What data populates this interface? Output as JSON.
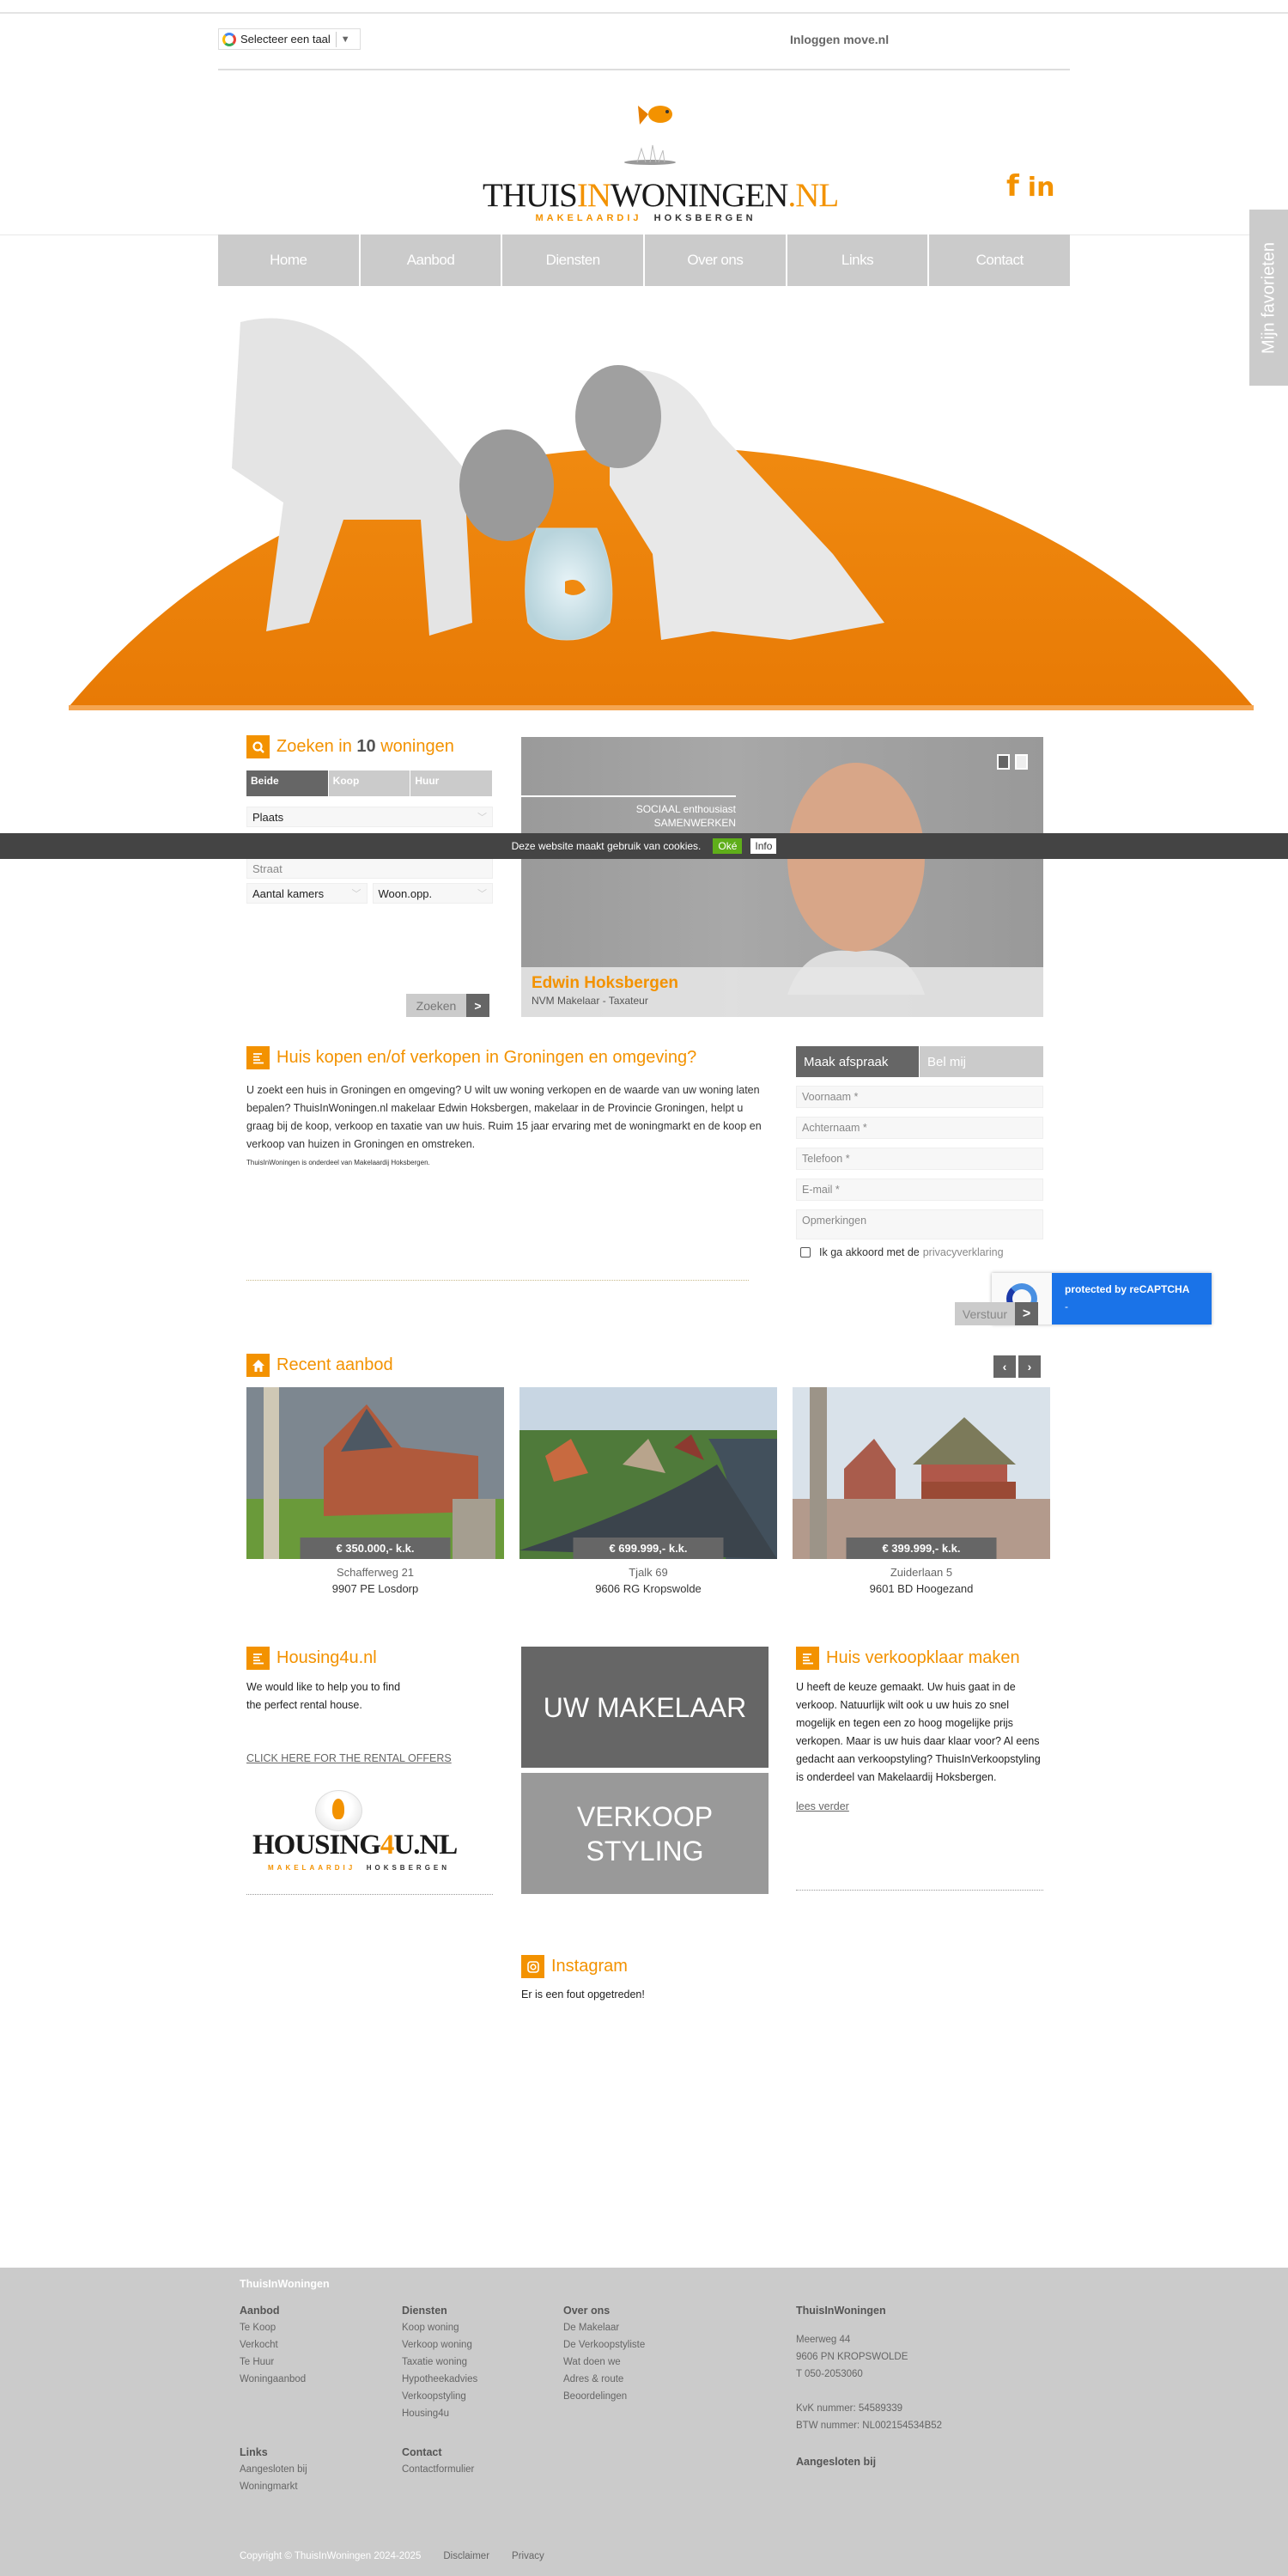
{
  "topbar": {
    "language_selector": "Selecteer een taal",
    "login_link": "Inloggen move.nl"
  },
  "logo": {
    "part1": "THUIS",
    "part2": "IN",
    "part3": "WONINGEN",
    "part4": ".NL",
    "sub1": "MAKELAARDIJ",
    "sub2": "HOKSBERGEN"
  },
  "social": {
    "facebook": "f",
    "linkedin": "in"
  },
  "nav": [
    "Home",
    "Aanbod",
    "Diensten",
    "Over ons",
    "Links",
    "Contact"
  ],
  "favorites_tab": "Mijn favorieten",
  "search": {
    "title_pre": "Zoeken in",
    "count": "10",
    "title_post": "woningen",
    "tabs": [
      "Beide",
      "Koop",
      "Huur"
    ],
    "active_tab": "Beide",
    "place": "Plaats",
    "street_placeholder": "Straat",
    "rooms": "Aantal kamers",
    "area": "Woon.opp.",
    "button": "Zoeken"
  },
  "agent": {
    "quote_line1": "SOCIAAL enthousiast",
    "quote_line2": "SAMENWERKEN",
    "name": "Edwin Hoksbergen",
    "role": "NVM Makelaar - Taxateur"
  },
  "cookie": {
    "message": "Deze website maakt gebruik van cookies.",
    "ok": "Oké",
    "info": "Info"
  },
  "about": {
    "title": "Huis kopen en/of verkopen in Groningen en omgeving?",
    "body": "U zoekt een huis in Groningen en omgeving? U wilt uw woning verkopen en de waarde van uw woning laten bepalen? ThuisInWoningen.nl makelaar Edwin Hoksbergen, makelaar in de Provincie Groningen, helpt u graag bij de koop, verkoop en taxatie van uw huis. Ruim 15 jaar ervaring met de woningmarkt en de koop en verkoop van huizen in Groningen en omstreken.",
    "note": "ThuisInWoningen is onderdeel van Makelaardij Hoksbergen."
  },
  "form": {
    "tabs": [
      "Maak afspraak",
      "Bel mij"
    ],
    "firstname": "Voornaam *",
    "lastname": "Achternaam *",
    "phone": "Telefoon *",
    "email": "E-mail *",
    "remarks": "Opmerkingen",
    "consent_pre": "Ik ga akkoord met de",
    "consent_link": "privacyverklaring",
    "submit": "Verstuur",
    "recaptcha": "protected by reCAPTCHA",
    "recaptcha_sub": "-"
  },
  "recent": {
    "title": "Recent aanbod",
    "items": [
      {
        "price": "€ 350.000,- k.k.",
        "street": "Schafferweg 21",
        "city": "9907 PE Losdorp"
      },
      {
        "price": "€ 699.999,- k.k.",
        "street": "Tjalk 69",
        "city": "9606 RG Kropswolde"
      },
      {
        "price": "€ 399.999,- k.k.",
        "street": "Zuiderlaan 5",
        "city": "9601 BD Hoogezand"
      }
    ]
  },
  "housing4u": {
    "title": "Housing4u.nl",
    "body_line1": "We would like to help you to find",
    "body_line2": "the perfect rental house.",
    "link": "CLICK HERE FOR THE RENTAL OFFERS",
    "logo_part1": "HOUSING",
    "logo_part2": "4",
    "logo_part3": "U.NL",
    "logo_sub1": "MAKELAARDIJ",
    "logo_sub2": "HOKSBERGEN"
  },
  "tiles": {
    "makelaar": "UW MAKELAAR",
    "styling_line1": "VERKOOP",
    "styling_line2": "STYLING"
  },
  "verkoopklaar": {
    "title": "Huis verkoopklaar maken",
    "body": "U heeft de keuze gemaakt. Uw huis gaat in de verkoop. Natuurlijk wilt ook u uw huis zo snel mogelijk en tegen een zo hoog mogelijke prijs verkopen. Maar is uw huis daar klaar voor? Al eens gedacht aan verkoopstyling? ThuisInVerkoopstyling is onderdeel van Makelaardij Hoksbergen.",
    "link": "lees verder"
  },
  "instagram": {
    "title": "Instagram",
    "error": "Er is een fout opgetreden!"
  },
  "footer": {
    "brand": "ThuisInWoningen",
    "aanbod": {
      "title": "Aanbod",
      "links": [
        "Te Koop",
        "Verkocht",
        "Te Huur",
        "Woningaanbod"
      ]
    },
    "diensten": {
      "title": "Diensten",
      "links": [
        "Koop woning",
        "Verkoop woning",
        "Taxatie woning",
        "Hypotheekadvies",
        "Verkoopstyling",
        "Housing4u"
      ]
    },
    "overons": {
      "title": "Over ons",
      "links": [
        "De Makelaar",
        "De Verkoopstyliste",
        "Wat doen we",
        "Adres & route",
        "Beoordelingen"
      ]
    },
    "company": {
      "title": "ThuisInWoningen",
      "street": "Meerweg 44",
      "zip_city": "9606 PN  KROPSWOLDE",
      "phone": "T 050-2053060",
      "kvk": "KvK nummer: 54589339",
      "btw": "BTW nummer: NL002154534B52",
      "affiliated": "Aangesloten bij"
    },
    "links": {
      "title": "Links",
      "links": [
        "Aangesloten bij",
        "Woningmarkt"
      ]
    },
    "contact": {
      "title": "Contact",
      "links": [
        "Contactformulier"
      ]
    },
    "copyright": "Copyright © ThuisInWoningen 2024-2025",
    "disclaimer": "Disclaimer",
    "privacy": "Privacy"
  }
}
